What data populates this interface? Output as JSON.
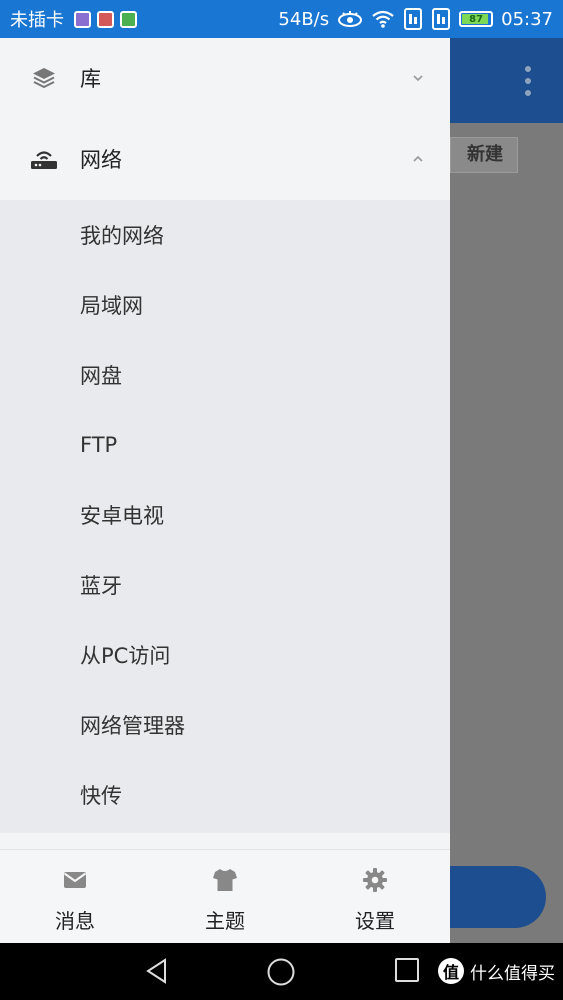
{
  "status_bar": {
    "carrier": "未插卡",
    "net_speed": "54B/s",
    "battery_level": "87",
    "time": "05:37"
  },
  "background_app": {
    "new_button_label": "新建",
    "more_menu_icon": "more-vertical-icon"
  },
  "drawer": {
    "sections": [
      {
        "label": "库",
        "icon": "layers-icon",
        "expanded": false
      },
      {
        "label": "网络",
        "icon": "router-icon",
        "expanded": true
      }
    ],
    "network_items": [
      "我的网络",
      "局域网",
      "网盘",
      "FTP",
      "安卓电视",
      "蓝牙",
      "从PC访问",
      "网络管理器",
      "快传"
    ],
    "bottom_nav": [
      {
        "label": "消息",
        "icon": "envelope-icon"
      },
      {
        "label": "主题",
        "icon": "tshirt-icon"
      },
      {
        "label": "设置",
        "icon": "gear-icon"
      }
    ]
  },
  "system_nav": {
    "watermark_logo": "值",
    "watermark_text": "什么值得买"
  },
  "colors": {
    "accent": "#1976d2",
    "drawer_bg": "#f2f4f6",
    "submenu_bg": "#e8eaed"
  }
}
